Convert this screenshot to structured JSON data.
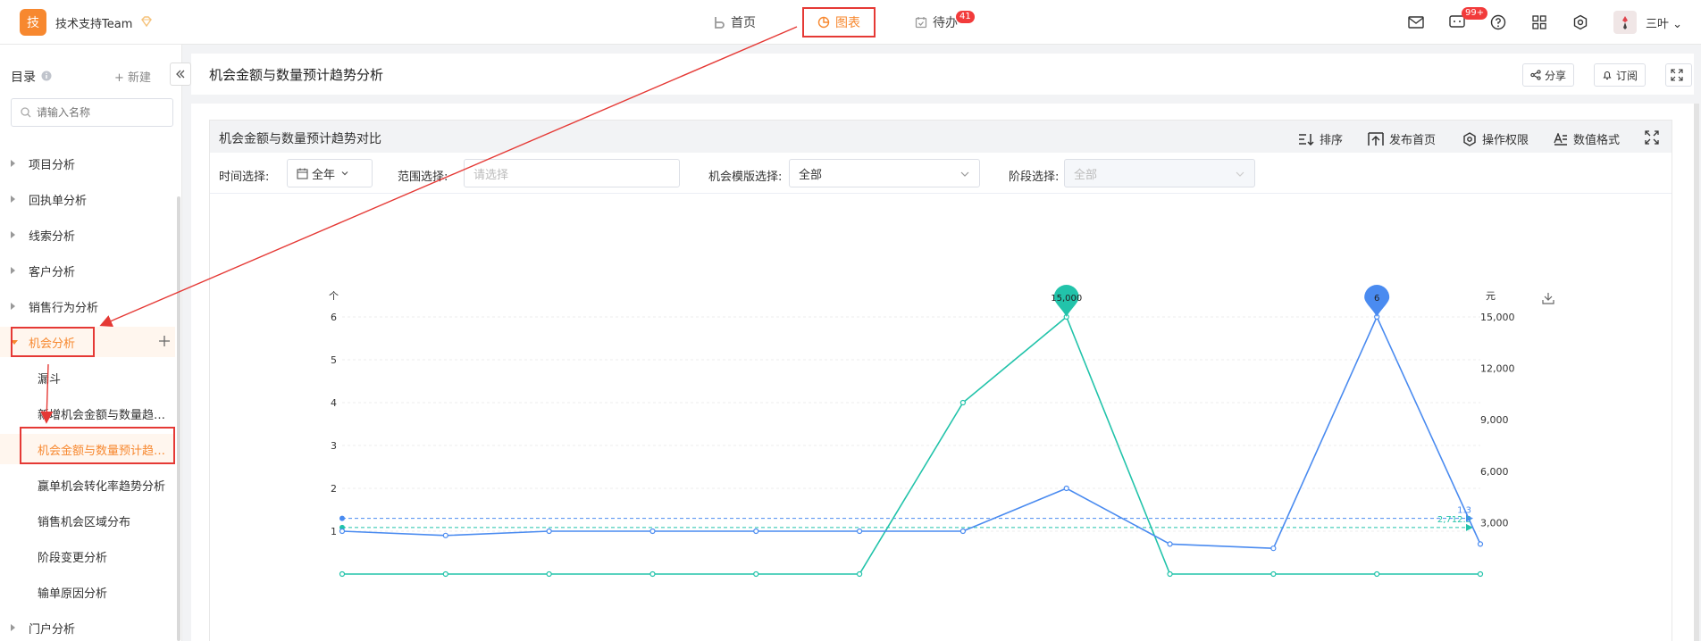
{
  "header": {
    "logo_char": "技",
    "team_name": "技术支持Team",
    "nav": {
      "home": "首页",
      "chart": "图表",
      "todo": "待办",
      "todo_badge": "41"
    },
    "message_badge": "99+",
    "user_name": "三叶"
  },
  "sidebar": {
    "title": "目录",
    "new_label": "+ 新建",
    "search_placeholder": "请输入名称",
    "items": [
      {
        "label": "项目分析"
      },
      {
        "label": "回执单分析"
      },
      {
        "label": "线索分析"
      },
      {
        "label": "客户分析"
      },
      {
        "label": "销售行为分析"
      },
      {
        "label": "机会分析"
      },
      {
        "label": "门户分析"
      }
    ],
    "children": [
      {
        "label": "漏斗"
      },
      {
        "label": "新增机会金额与数量趋势分析"
      },
      {
        "label": "机会金额与数量预计趋势分析"
      },
      {
        "label": "赢单机会转化率趋势分析"
      },
      {
        "label": "销售机会区域分布"
      },
      {
        "label": "阶段变更分析"
      },
      {
        "label": "输单原因分析"
      }
    ]
  },
  "page": {
    "title": "机会金额与数量预计趋势分析",
    "share": "分享",
    "subscribe": "订阅"
  },
  "panel": {
    "title": "机会金额与数量预计趋势对比",
    "tools": {
      "sort": "排序",
      "publish": "发布首页",
      "permission": "操作权限",
      "format": "数值格式"
    },
    "filters": {
      "time_label": "时间选择:",
      "time_value": "全年",
      "range_label": "范围选择:",
      "range_placeholder": "请选择",
      "template_label": "机会模版选择:",
      "template_value": "全部",
      "stage_label": "阶段选择:",
      "stage_value": "全部"
    }
  },
  "chart_data": {
    "type": "line",
    "left_axis_unit": "个",
    "right_axis_unit": "元",
    "y_left_ticks": [
      "1",
      "2",
      "3",
      "4",
      "5",
      "6"
    ],
    "y_right_ticks": [
      "3,000",
      "6,000",
      "9,000",
      "12,000",
      "15,000"
    ],
    "ylim_left": [
      0,
      6
    ],
    "ylim_right": [
      0,
      15000
    ],
    "grid": true,
    "series": [
      {
        "axis": "right",
        "color": "#22c3aa",
        "x": [
          1,
          2,
          3,
          4,
          5,
          6,
          7,
          8,
          9,
          10,
          11,
          12
        ],
        "values": [
          0,
          0,
          0,
          0,
          0,
          0,
          10000,
          15000,
          0,
          0,
          0,
          0
        ]
      },
      {
        "axis": "left",
        "color": "#4a8bf0",
        "x": [
          1,
          2,
          3,
          4,
          5,
          6,
          7,
          8,
          9,
          10,
          11,
          12
        ],
        "values": [
          1,
          0.9,
          1,
          1,
          1,
          1,
          1,
          2,
          0.7,
          0.6,
          6,
          0.7
        ]
      }
    ],
    "markers": [
      {
        "series": 0,
        "point": 8,
        "label": "15,000"
      },
      {
        "series": 1,
        "point": 11,
        "label": "6"
      }
    ],
    "average_lines": [
      {
        "series": 1,
        "value": 1.3,
        "label": "1.3",
        "color": "#4a8bf0"
      },
      {
        "series": 0,
        "value": 2712.5,
        "label": "2,712.5",
        "color": "#22c3aa"
      }
    ]
  }
}
